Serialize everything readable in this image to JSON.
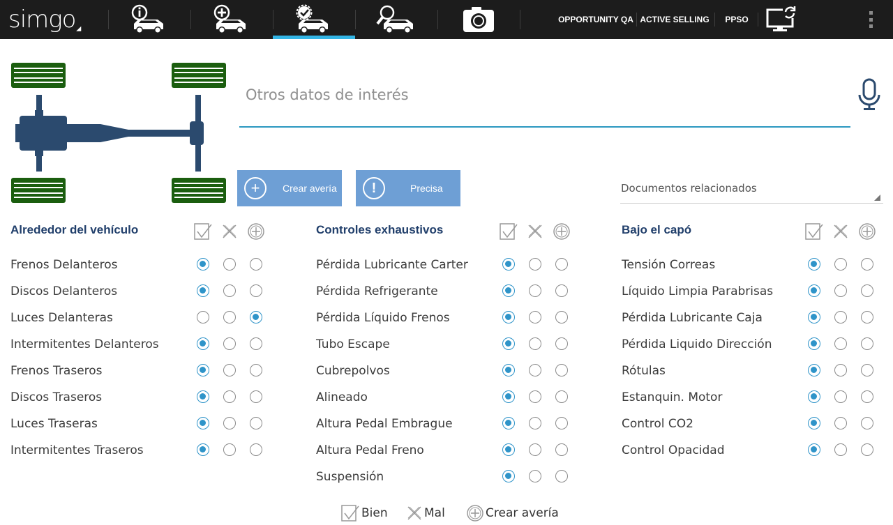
{
  "app": {
    "logo_text": "simgo"
  },
  "nav": {
    "tabs": [
      {
        "icon": "car-info-icon",
        "active": false
      },
      {
        "icon": "car-add-icon",
        "active": false
      },
      {
        "icon": "car-check-icon",
        "active": true
      },
      {
        "icon": "car-search-icon",
        "active": false
      },
      {
        "icon": "camera-icon",
        "active": false
      }
    ],
    "links": [
      "OPPORTUNITY QA",
      "ACTIVE SELLING",
      "PPSO"
    ],
    "sync_icon": "monitor-sync-icon",
    "menu_icon": "overflow-menu-icon"
  },
  "notes": {
    "placeholder": "Otros datos de interés",
    "value": ""
  },
  "buttons": {
    "create_label": "Crear avería",
    "precisa_label": "Precisa"
  },
  "documents": {
    "label": "Documentos relacionados"
  },
  "columns": [
    {
      "title": "Alrededor del vehículo",
      "items": [
        {
          "label": "Frenos Delanteros",
          "state": "bien"
        },
        {
          "label": "Discos Delanteros",
          "state": "bien"
        },
        {
          "label": "Luces Delanteras",
          "state": "crear"
        },
        {
          "label": "Intermitentes Delanteros",
          "state": "bien"
        },
        {
          "label": "Frenos Traseros",
          "state": "bien"
        },
        {
          "label": "Discos Traseros",
          "state": "bien"
        },
        {
          "label": "Luces Traseras",
          "state": "bien"
        },
        {
          "label": "Intermitentes Traseros",
          "state": "bien"
        }
      ]
    },
    {
      "title": "Controles exhaustivos",
      "items": [
        {
          "label": "Pérdida Lubricante Carter",
          "state": "bien"
        },
        {
          "label": "Pérdida Refrigerante",
          "state": "bien"
        },
        {
          "label": "Pérdida Líquido Frenos",
          "state": "bien"
        },
        {
          "label": "Tubo Escape",
          "state": "bien"
        },
        {
          "label": "Cubrepolvos",
          "state": "bien"
        },
        {
          "label": "Alineado",
          "state": "bien"
        },
        {
          "label": "Altura Pedal Embrague",
          "state": "bien"
        },
        {
          "label": "Altura Pedal Freno",
          "state": "bien"
        },
        {
          "label": "Suspensión",
          "state": "bien"
        }
      ]
    },
    {
      "title": "Bajo el capó",
      "items": [
        {
          "label": "Tensión Correas",
          "state": "bien"
        },
        {
          "label": "Líquido Limpia Parabrisas",
          "state": "bien"
        },
        {
          "label": "Pérdida Lubricante Caja",
          "state": "bien"
        },
        {
          "label": "Pérdida Liquido Dirección",
          "state": "bien"
        },
        {
          "label": "Rótulas",
          "state": "bien"
        },
        {
          "label": "Estanquin. Motor",
          "state": "bien"
        },
        {
          "label": "Control CO2",
          "state": "bien"
        },
        {
          "label": "Control Opacidad",
          "state": "bien"
        }
      ]
    }
  ],
  "legend": {
    "bien": "Bien",
    "mal": "Mal",
    "crear": "Crear avería"
  },
  "colors": {
    "topbar": "#1c1c1c",
    "accent": "#33b5e5",
    "button": "#6e9fd5",
    "radio": "#2f94c9",
    "title": "#213f6b",
    "wheel": "#1b5e0f",
    "chassis": "#2b4a6e"
  }
}
